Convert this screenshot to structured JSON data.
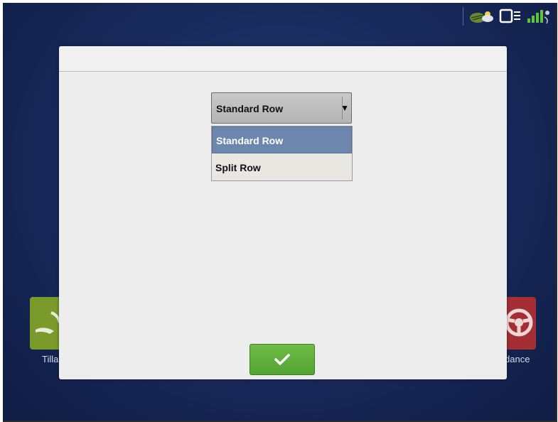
{
  "background": {
    "tiles": [
      {
        "label": "Tilla",
        "color": "#7a9a2c",
        "icon": "tillage-icon"
      },
      {
        "label": "dance",
        "color": "#a32f34",
        "icon": "steering-wheel-icon"
      }
    ]
  },
  "status_icons": [
    "field-weather-icon",
    "display-connection-icon",
    "gps-signal-icon"
  ],
  "dialog": {
    "dropdown": {
      "selected": "Standard Row",
      "options": [
        "Standard Row",
        "Split Row"
      ],
      "highlighted_index": 0
    },
    "confirm_icon": "checkmark-icon"
  },
  "colors": {
    "accent_green": "#5cae3a",
    "highlight_blue": "#6d86ae",
    "background_navy": "#17285a"
  }
}
